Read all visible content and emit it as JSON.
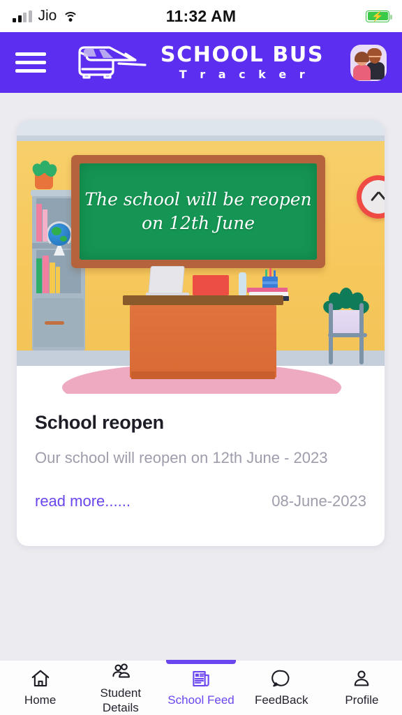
{
  "status_bar": {
    "carrier": "Jio",
    "time": "11:32 AM",
    "signal_icon": "cellular-signal-icon",
    "wifi_icon": "wifi-icon",
    "battery_icon": "battery-charging-icon"
  },
  "header": {
    "menu_icon": "hamburger-menu-icon",
    "logo_icon": "school-bus-logo-icon",
    "title": "SCHOOL BUS",
    "subtitle": "T r a c k e r",
    "avatar_icon": "parents-avatar-icon",
    "background_color": "#5b2ef0"
  },
  "feed_card": {
    "illustration": {
      "alt": "classroom-illustration",
      "chalkboard_line_1": "The school will be reopen",
      "chalkboard_line_2": "on 12th June",
      "wall_color": "#f6c85c",
      "board_color": "#149553",
      "frame_color": "#b5633c"
    },
    "title": "School reopen",
    "description": "Our school will reopen on 12th June - 2023",
    "read_more_label": "read more......",
    "date": "08-June-2023",
    "link_color": "#6b45ef"
  },
  "bottom_nav": {
    "active_index": 2,
    "accent_color": "#6b45ef",
    "items": [
      {
        "label": "Home",
        "icon": "home-icon"
      },
      {
        "label": "Student\nDetails",
        "label_line1": "Student",
        "label_line2": "Details",
        "icon": "users-group-icon"
      },
      {
        "label": "School Feed",
        "icon": "newspaper-icon"
      },
      {
        "label": "FeedBack",
        "icon": "chat-bubble-icon"
      },
      {
        "label": "Profile",
        "icon": "person-icon"
      }
    ]
  }
}
